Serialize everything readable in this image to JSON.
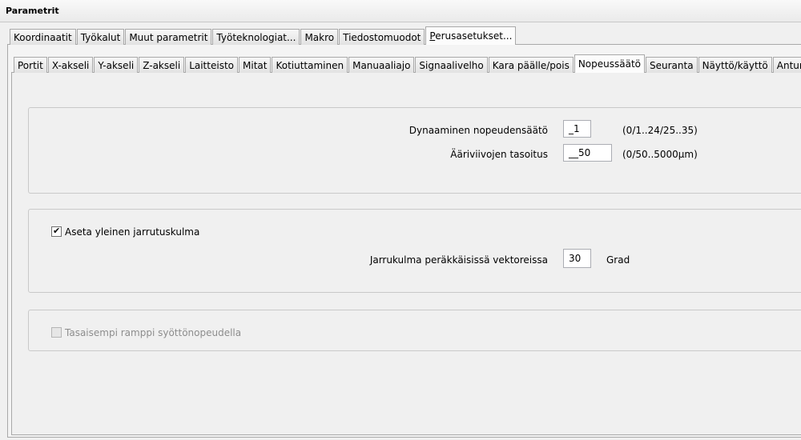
{
  "window": {
    "title": "Parametrit"
  },
  "main_tabs": [
    {
      "label": "Koordinaatit"
    },
    {
      "label": "Työkalut"
    },
    {
      "label": "Muut parametrit"
    },
    {
      "label": "Työteknologiat..."
    },
    {
      "label": "Makro"
    },
    {
      "label": "Tiedostomuodot"
    },
    {
      "label_first": "P",
      "label_rest": "erusasetukset...",
      "active": true
    }
  ],
  "sub_tabs": [
    {
      "label": "Portit"
    },
    {
      "label": "X-akseli"
    },
    {
      "label": "Y-akseli"
    },
    {
      "label": "Z-akseli"
    },
    {
      "label": "Laitteisto"
    },
    {
      "label": "Mitat"
    },
    {
      "label": "Kotiuttaminen"
    },
    {
      "label": "Manuaaliajo"
    },
    {
      "label": "Signaalivelho"
    },
    {
      "label": "Kara päälle/pois"
    },
    {
      "label": "Nopeussäätö",
      "active": true
    },
    {
      "label": "Seuranta"
    },
    {
      "label": "Näyttö/käyttö"
    },
    {
      "label": "Anturi"
    }
  ],
  "group1": {
    "dynamic_label": "Dynaaminen nopeudensäätö",
    "dynamic_value": "_1",
    "dynamic_range": "(0/1..24/25..35)",
    "contour_label": "Ääriviivojen tasoitus",
    "contour_value": "__50",
    "contour_range": "(0/50..5000µm)"
  },
  "group2": {
    "checkbox_label": "Aseta yleinen jarrutuskulma",
    "checked": true,
    "brake_label": "Jarrukulma peräkkäisissä vektoreissa",
    "brake_value": "30",
    "brake_unit": "Grad"
  },
  "group3": {
    "checkbox_label": "Tasaisempi ramppi syöttönopeudella",
    "checked": false,
    "disabled": true
  }
}
